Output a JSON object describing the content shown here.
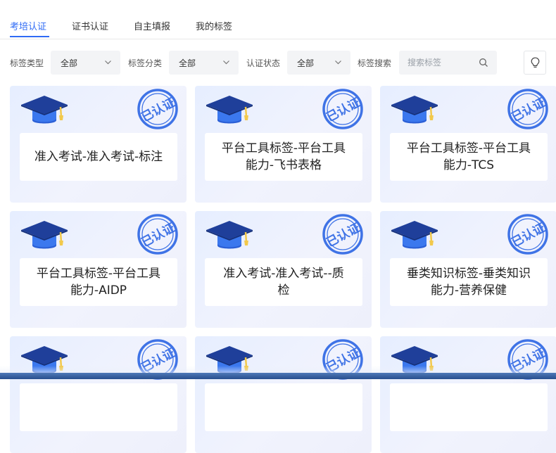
{
  "tabs": [
    {
      "label": "考培认证",
      "active": true
    },
    {
      "label": "证书认证",
      "active": false
    },
    {
      "label": "自主填报",
      "active": false
    },
    {
      "label": "我的标签",
      "active": false
    }
  ],
  "filters": {
    "type_label": "标签类型",
    "type_value": "全部",
    "category_label": "标签分类",
    "category_value": "全部",
    "status_label": "认证状态",
    "status_value": "全部",
    "search_label": "标签搜索",
    "search_placeholder": "搜索标签"
  },
  "icons": {
    "search": "search-icon",
    "help": "lightbulb-icon",
    "card_icon": "graduation-cap-icon",
    "card_stamp": "certified-stamp-icon"
  },
  "stamp_text": "已认证",
  "colors": {
    "accent": "#2f6bf5",
    "stamp": "#3f73e6",
    "cap_top": "#1f3f9a",
    "cap_body": "#3b78ee",
    "tassel": "#f2c94c"
  },
  "cards": [
    {
      "title": "准入考试-准入考试-标注"
    },
    {
      "title": "平台工具标签-平台工具能力-飞书表格"
    },
    {
      "title": "平台工具标签-平台工具能力-TCS"
    },
    {
      "title": "平台工具标签-平台工具能力-AIDP"
    },
    {
      "title": "准入考试-准入考试--质检"
    },
    {
      "title": "垂类知识标签-垂类知识能力-营养保健"
    },
    {
      "title": ""
    },
    {
      "title": ""
    },
    {
      "title": ""
    }
  ]
}
